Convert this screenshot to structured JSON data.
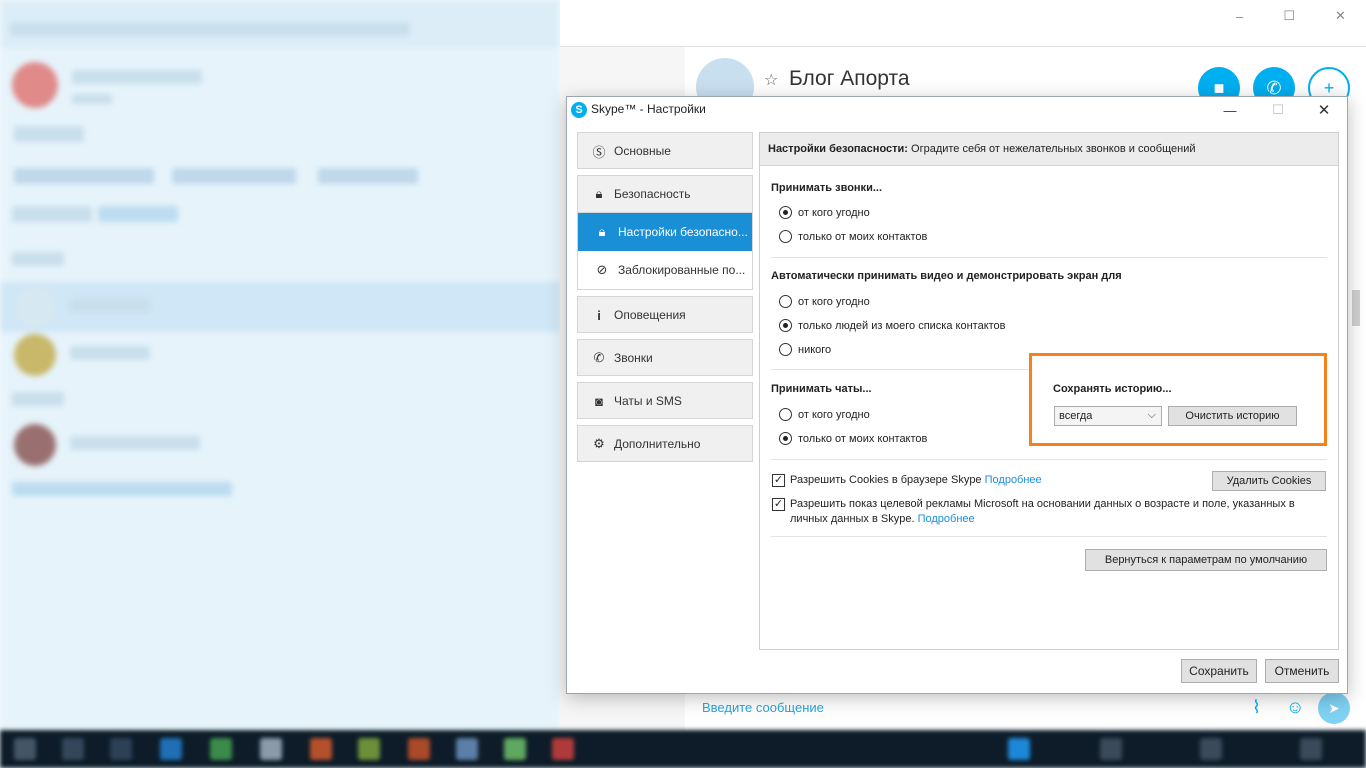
{
  "background": {
    "conversation_title": "Блог Апорта",
    "message_placeholder": "Введите сообщение",
    "window_controls": [
      "–",
      "☐",
      "✕"
    ]
  },
  "dialog": {
    "title": "Skype™ - Настройки",
    "controls": {
      "minimize": "—",
      "maximize": "☐",
      "close": "✕"
    },
    "nav": {
      "general": "Основные",
      "security": "Безопасность",
      "security_settings": "Настройки безопасно...",
      "blocked": "Заблокированные по...",
      "notifications": "Оповещения",
      "calls": "Звонки",
      "chats": "Чаты и SMS",
      "advanced": "Дополнительно"
    },
    "header": {
      "bold": "Настройки безопасности:",
      "text": " Оградите себя от нежелательных звонков и сообщений"
    },
    "accept_calls": {
      "title": "Принимать звонки...",
      "options": [
        "от кого угодно",
        "только от моих контактов"
      ],
      "selected": 0
    },
    "auto_video": {
      "title": "Автоматически принимать видео и демонстрировать экран для",
      "options": [
        "от кого угодно",
        "только людей из моего списка контактов",
        "никого"
      ],
      "selected": 1
    },
    "accept_chats": {
      "title": "Принимать чаты...",
      "options": [
        "от кого угодно",
        "только от моих контактов"
      ],
      "selected": 1
    },
    "history": {
      "title": "Сохранять историю...",
      "value": "всегда",
      "clear_button": "Очистить историю"
    },
    "cookies": {
      "label": "Разрешить Cookies в браузере Skype",
      "link": "Подробнее",
      "checked": true,
      "delete_button": "Удалить Cookies"
    },
    "ads": {
      "label": "Разрешить показ целевой рекламы Microsoft на основании данных о возрасте и поле, указанных в личных данных в Skype.",
      "link": "Подробнее",
      "checked": true
    },
    "reset_button": "Вернуться к параметрам по умолчанию",
    "save_button": "Сохранить",
    "cancel_button": "Отменить"
  },
  "colors": {
    "accent": "#00aff0",
    "nav_active": "#1a8fd6",
    "highlight_box": "#f7811e"
  }
}
